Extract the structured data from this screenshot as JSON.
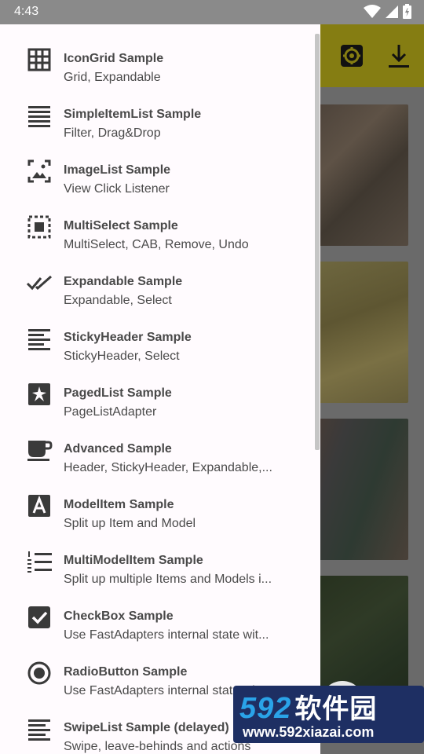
{
  "status_bar": {
    "time": "4:43"
  },
  "drawer": {
    "items": [
      {
        "title": "IconGrid Sample",
        "subtitle": "Grid, Expandable",
        "icon": "grid-icon"
      },
      {
        "title": "SimpleItemList Sample",
        "subtitle": "Filter, Drag&Drop",
        "icon": "list-lines-icon"
      },
      {
        "title": "ImageList Sample",
        "subtitle": "View Click Listener",
        "icon": "image-icon"
      },
      {
        "title": "MultiSelect Sample",
        "subtitle": "MultiSelect, CAB, Remove, Undo",
        "icon": "select-all-icon"
      },
      {
        "title": "Expandable Sample",
        "subtitle": "Expandable, Select",
        "icon": "double-check-icon"
      },
      {
        "title": "StickyHeader Sample",
        "subtitle": "StickyHeader, Select",
        "icon": "align-left-icon"
      },
      {
        "title": "PagedList Sample",
        "subtitle": "PageListAdapter",
        "icon": "puzzle-icon"
      },
      {
        "title": "Advanced Sample",
        "subtitle": "Header, StickyHeader, Expandable,...",
        "icon": "coffee-icon"
      },
      {
        "title": "ModelItem Sample",
        "subtitle": "Split up Item and Model",
        "icon": "letter-a-icon"
      },
      {
        "title": "MultiModelItem Sample",
        "subtitle": "Split up multiple Items and Models i...",
        "icon": "numbered-list-icon"
      },
      {
        "title": "CheckBox Sample",
        "subtitle": "Use FastAdapters internal state wit...",
        "icon": "checkbox-icon"
      },
      {
        "title": "RadioButton Sample",
        "subtitle": "Use FastAdapters internal state wit...",
        "icon": "radio-button-icon"
      },
      {
        "title": "SwipeList Sample (delayed)",
        "subtitle": "Swipe, leave-behinds and actions",
        "icon": "lines-icon"
      }
    ]
  },
  "watermark": {
    "logo_digits": "592",
    "logo_text": "软件园",
    "url": "www.592xiazai.com"
  },
  "colors": {
    "toolbar": "#857d12",
    "drawer_bg": "#fffbfe",
    "scrim": "#5d5d5d",
    "watermark_bg": "#1e2f63",
    "watermark_accent": "#2aa3e8"
  }
}
